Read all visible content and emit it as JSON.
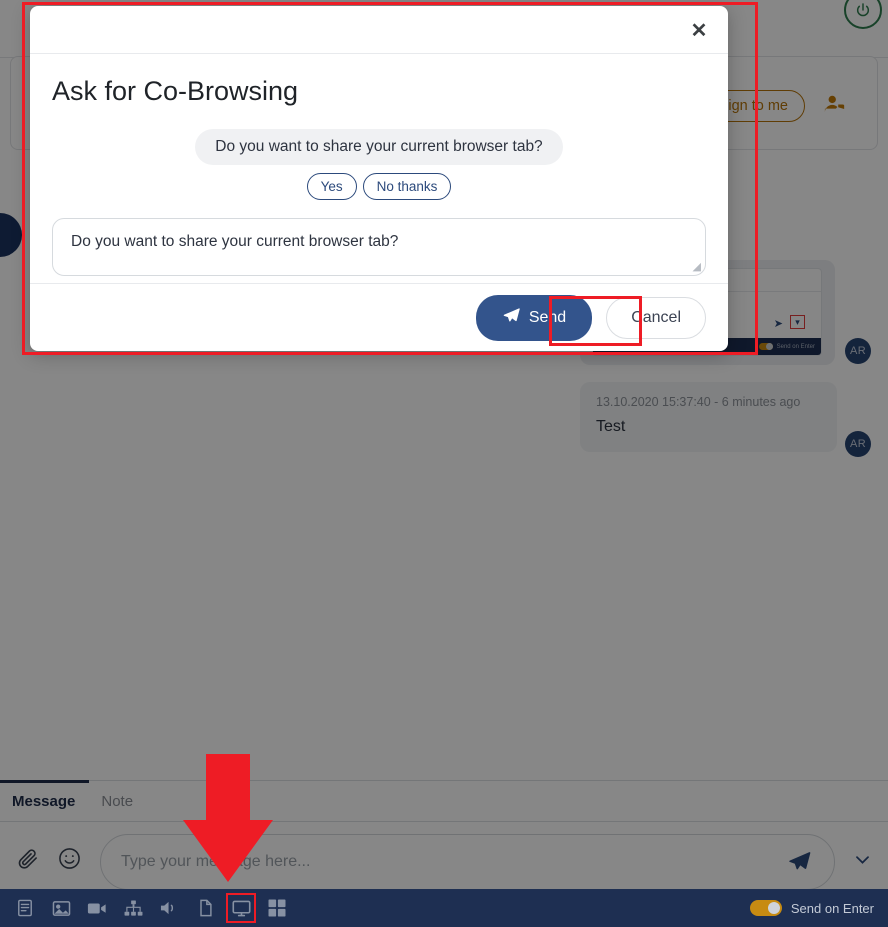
{
  "modal": {
    "title": "Ask for Co-Browsing",
    "close_label": "✕",
    "preview_message": "Do you want to share your current browser tab?",
    "quick_replies": [
      "Yes",
      "No thanks"
    ],
    "textarea_value": "Do you want to share your current browser tab?",
    "send_label": "Send",
    "send_icon": "paper-plane-icon",
    "cancel_label": "Cancel"
  },
  "background": {
    "assign_button": "Assign to me",
    "assign_icon": "person-tag-icon",
    "power_icon": "⏻",
    "messages": [
      {
        "avatar": "AR",
        "type": "screenshot-attachment",
        "mini": {
          "send_label": "Send on Enter",
          "send_icon": "paper-plane-icon",
          "dropdown_icon": "chevron-down-icon"
        }
      },
      {
        "avatar": "AR",
        "type": "text",
        "timestamp": "13.10.2020 15:37:40 - 6 minutes ago",
        "body": "Test"
      }
    ]
  },
  "composer": {
    "tabs": [
      {
        "label": "Message",
        "active": true
      },
      {
        "label": "Note",
        "active": false
      }
    ],
    "attach_icon": "paperclip-icon",
    "emoji_icon": "smiley-icon",
    "input_placeholder": "Type your message here...",
    "send_icon": "paper-plane-icon",
    "dropdown_icon": "chevron-down-icon"
  },
  "toolbar": {
    "icons": [
      {
        "name": "article-icon",
        "glyph": "☰",
        "highlighted": false
      },
      {
        "name": "image-icon",
        "glyph": "ὛC",
        "highlighted": false
      },
      {
        "name": "video-icon",
        "glyph": "▶",
        "highlighted": false
      },
      {
        "name": "sitemap-icon",
        "glyph": "⑂",
        "highlighted": false
      },
      {
        "name": "sound-icon",
        "glyph": "◀",
        "highlighted": false
      },
      {
        "name": "file-icon",
        "glyph": "▭",
        "highlighted": false
      },
      {
        "name": "screen-share-icon",
        "glyph": "▭",
        "highlighted": true
      },
      {
        "name": "apps-grid-icon",
        "glyph": "⊞",
        "highlighted": false
      }
    ],
    "send_on_enter_label": "Send on Enter",
    "send_on_enter_on": true
  },
  "annotations": {
    "highlight_color": "#ee1c25",
    "arrow_direction": "down",
    "arrow_target": "screen-share-icon"
  }
}
